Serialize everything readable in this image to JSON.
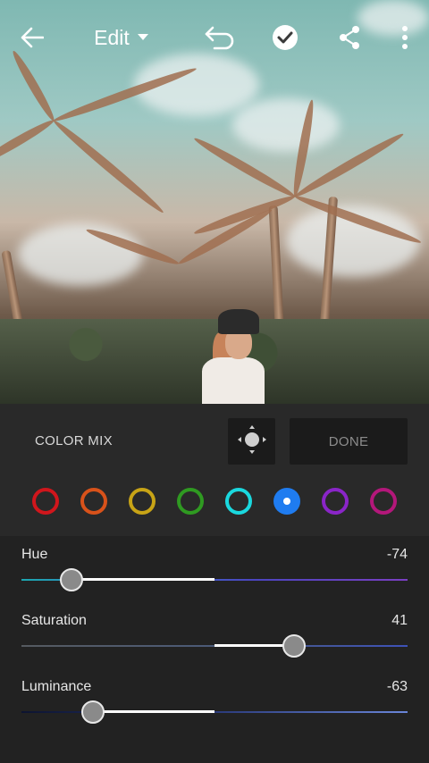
{
  "topbar": {
    "back_icon": "arrow-left-icon",
    "title": "Edit",
    "title_icon": "caret-down-icon",
    "undo_icon": "undo-icon",
    "confirm_icon": "check-circle-icon",
    "share_icon": "share-icon",
    "more_icon": "more-vertical-icon"
  },
  "colormix": {
    "label": "COLOR MIX",
    "target_icon": "target-adjust-icon",
    "done_label": "DONE",
    "swatches": [
      {
        "name": "red",
        "color": "#d0161c",
        "selected": false
      },
      {
        "name": "orange",
        "color": "#d8521a",
        "selected": false
      },
      {
        "name": "yellow",
        "color": "#c8a416",
        "selected": false
      },
      {
        "name": "green",
        "color": "#2f9a21",
        "selected": false
      },
      {
        "name": "aqua",
        "color": "#1ad8de",
        "selected": false
      },
      {
        "name": "blue",
        "color": "#1f7cf0",
        "selected": true
      },
      {
        "name": "purple",
        "color": "#8a25c8",
        "selected": false
      },
      {
        "name": "magenta",
        "color": "#b3177a",
        "selected": false
      }
    ]
  },
  "sliders": {
    "hue": {
      "label": "Hue",
      "value": "-74",
      "numeric": -74
    },
    "saturation": {
      "label": "Saturation",
      "value": "41",
      "numeric": 41
    },
    "luminance": {
      "label": "Luminance",
      "value": "-63",
      "numeric": -63
    }
  }
}
